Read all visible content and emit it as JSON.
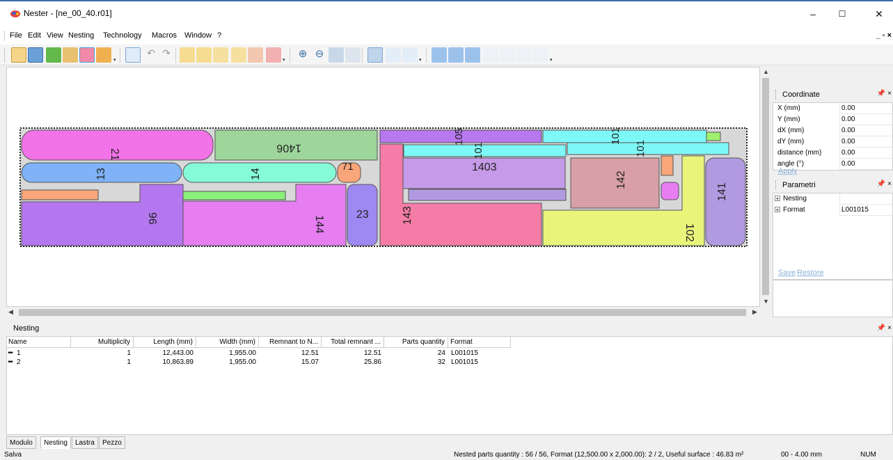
{
  "window": {
    "title": "Nester - [ne_00_40.r01]",
    "minimize": "–",
    "maximize": "☐",
    "close": "✕"
  },
  "menu": {
    "items": [
      "File",
      "Edit",
      "View",
      "Nesting",
      "Technology",
      "Macros",
      "Window",
      "?"
    ],
    "mdi_controls": "_ ▫ ×"
  },
  "toolbar": {
    "icons": [
      "new-icon",
      "save-icon",
      "open-part-icon",
      "edit-part-icon",
      "nest-icon",
      "import-icon",
      "select-icon",
      "undo-icon",
      "redo-icon",
      "copy-icon",
      "paste-icon",
      "rotate-icon",
      "mirror-icon",
      "cut-icon",
      "delete-icon",
      "zoom-in-icon",
      "zoom-out-icon",
      "zoom-fit-icon",
      "refresh-icon",
      "grid-icon",
      "align-icon",
      "stack-icon",
      "auto1-icon",
      "auto2-icon",
      "auto3-icon",
      "move-up-icon",
      "move-down-icon",
      "swap-icon",
      "split-icon"
    ]
  },
  "coordinate_panel": {
    "title": "Coordinate",
    "rows": [
      {
        "label": "X (mm)",
        "value": "0.00"
      },
      {
        "label": "Y (mm)",
        "value": "0.00"
      },
      {
        "label": "dX (mm)",
        "value": "0.00"
      },
      {
        "label": "dY (mm)",
        "value": "0.00"
      },
      {
        "label": "distance (mm)",
        "value": "0.00"
      },
      {
        "label": "angle (°)",
        "value": "0.00"
      }
    ],
    "apply": "Apply"
  },
  "parametri_panel": {
    "title": "Parametri",
    "rows": [
      {
        "label": "Nesting",
        "value": ""
      },
      {
        "label": "Format",
        "value": "L001015"
      }
    ],
    "save": "Save",
    "restore": "Restore"
  },
  "nesting_panel": {
    "title": "Nesting",
    "columns": [
      "Name",
      "Multiplicity",
      "Length (mm)",
      "Width (mm)",
      "Remnant to N...",
      "Total remnant ...",
      "Parts quantity",
      "Format"
    ],
    "rows": [
      {
        "name": "1",
        "multiplicity": "1",
        "length": "12,443.00",
        "width": "1,955.00",
        "remnant": "12.51",
        "total": "12.51",
        "parts": "24",
        "format": "L001015"
      },
      {
        "name": "2",
        "multiplicity": "1",
        "length": "10,863.89",
        "width": "1,955.00",
        "remnant": "15.07",
        "total": "25.86",
        "parts": "32",
        "format": "L001015"
      }
    ]
  },
  "tabs": [
    "Modulo",
    "Nesting",
    "Lastra",
    "Pezzo"
  ],
  "status": {
    "left": "Salva",
    "info": "Nested parts quantity : 56 / 56, Format (12,500.00 x 2,000.00): 2 / 2, Useful surface : 46.83 m²",
    "range": "00 - 4.00 mm",
    "num": "NUM"
  },
  "parts": [
    {
      "label": "21",
      "color": "#f272e8"
    },
    {
      "label": "1406",
      "color": "#9ed59a"
    },
    {
      "label": "105",
      "color": "#b778f0"
    },
    {
      "label": "101",
      "color": "#7ef7f7"
    },
    {
      "label": "13",
      "color": "#7fb2f7"
    },
    {
      "label": "14",
      "color": "#85fbd8"
    },
    {
      "label": "71",
      "color": "#f8a67a"
    },
    {
      "label": "1403",
      "color": "#c59ae8"
    },
    {
      "label": "142",
      "color": "#d8a0a6"
    },
    {
      "label": "96",
      "color": "#b577f0"
    },
    {
      "label": "144",
      "color": "#e67ef2"
    },
    {
      "label": "23",
      "color": "#9e88f2"
    },
    {
      "label": "143",
      "color": "#f57ca6"
    },
    {
      "label": "102",
      "color": "#e8f57a"
    },
    {
      "label": "141",
      "color": "#b29ae0"
    }
  ]
}
